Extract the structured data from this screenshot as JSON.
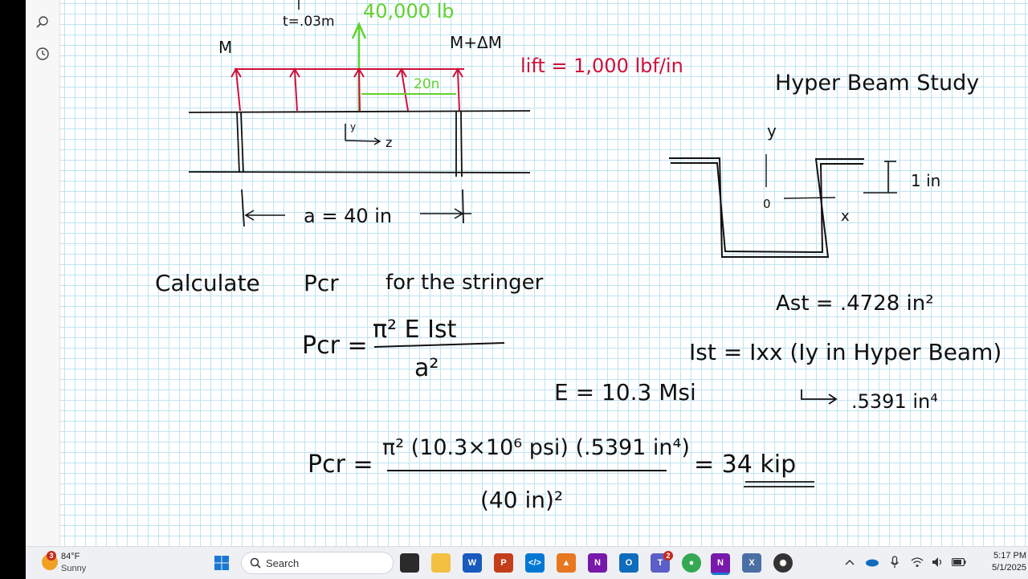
{
  "diagram": {
    "thickness_label": "t=.03m",
    "load_label": "40,000 lb",
    "moment_left": "M",
    "moment_right": "M+ΔM",
    "lift_label": "lift = 1,000 lbf/in",
    "spacing_label": "20n",
    "axis_y": "y",
    "axis_z": "z",
    "length_label": "a = 40 in"
  },
  "beam_study": {
    "title": "Hyper Beam Study",
    "axis_y": "y",
    "axis_x": "x",
    "origin": "0",
    "height_label": "1 in"
  },
  "work": {
    "calculate_text": "Calculate",
    "pcr_text": "Pcr",
    "for_text": "for the stringer",
    "formula_lhs": "Pcr =",
    "formula_num": "π² E Ist",
    "formula_den": "a²",
    "modulus": "E = 10.3 Msi",
    "area": "Ast = .4728 in²",
    "inertia_eq": "Ist = Ixx (Iy in Hyper Beam)",
    "inertia_val": ".5391 in⁴",
    "sub_lhs": "Pcr =",
    "sub_num": "π² (10.3×10⁶ psi) (.5391 in⁴)",
    "sub_den": "(40 in)²",
    "result": "= 34 kip"
  },
  "taskbar": {
    "weather_temp": "84°F",
    "weather_cond": "Sunny",
    "weather_badge": "3",
    "search_placeholder": "Search",
    "teams_badge": "2",
    "time": "5:17 PM",
    "date": "5/1/2025"
  },
  "colors": {
    "ink": "#111111",
    "red_ink": "#d0103a",
    "green_ink": "#63d12e",
    "grid": "#bfe3f1",
    "taskbar_bg": "#eef0f4"
  }
}
